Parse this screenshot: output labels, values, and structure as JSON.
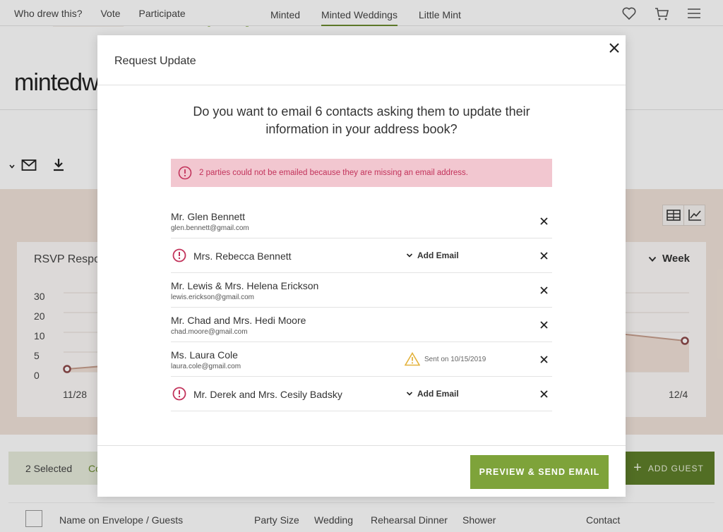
{
  "topnav": {
    "left_links": [
      "Who drew this?",
      "Vote",
      "Participate"
    ],
    "center_links": [
      "Minted",
      "Minted Weddings",
      "Little Mint"
    ],
    "active_center": "Minted Weddings",
    "icons": [
      "heart-icon",
      "cart-icon",
      "menu-icon"
    ]
  },
  "brand": {
    "text": "mintedw"
  },
  "toolbar": {
    "icons": [
      "chevron-down-icon",
      "mail-icon",
      "download-icon"
    ]
  },
  "view_toggle": {
    "icons": [
      "table-icon",
      "line-chart-icon"
    ]
  },
  "rsvp": {
    "title": "RSVP Respor",
    "range_label": "Week",
    "y_ticks": [
      "30",
      "20",
      "10",
      "5",
      "0"
    ],
    "x_start": "11/28",
    "x_end": "12/4"
  },
  "selection": {
    "count_label": "2 Selected",
    "more_label": "Co"
  },
  "add_guest": {
    "label": "ADD GUEST"
  },
  "table_head": {
    "name": "Name on Envelope / Guests",
    "party_size": "Party Size",
    "wedding": "Wedding",
    "rehearsal": "Rehearsal Dinner",
    "shower": "Shower",
    "contact": "Contact"
  },
  "modal": {
    "title": "Request Update",
    "question": "Do you want to email 6 contacts asking them to update their information in your address book?",
    "alert": "2 parties could not be emailed because they are missing an email address.",
    "contacts": [
      {
        "name": "Mr. Glen Bennett",
        "email": "glen.bennett@gmail.com"
      },
      {
        "name": "Mrs. Rebecca Bennett",
        "action": "Add Email"
      },
      {
        "name": "Mr. Lewis & Mrs. Helena Erickson",
        "email": "lewis.erickson@gmail.com"
      },
      {
        "name": "Mr. Chad and Mrs. Hedi Moore",
        "email": "chad.moore@gmail.com"
      },
      {
        "name": "Ms. Laura Cole",
        "email": "laura.cole@gmail.com",
        "status": "Sent on 10/15/2019"
      },
      {
        "name": "Mr. Derek and Mrs. Cesily Badsky",
        "action": "Add Email"
      }
    ],
    "send_button": "PREVIEW & SEND EMAIL"
  },
  "colors": {
    "accent_green": "#7ea33a",
    "alert_bg": "#f2c7d0",
    "alert_text": "#c2335b",
    "warning": "#e3b23c"
  }
}
